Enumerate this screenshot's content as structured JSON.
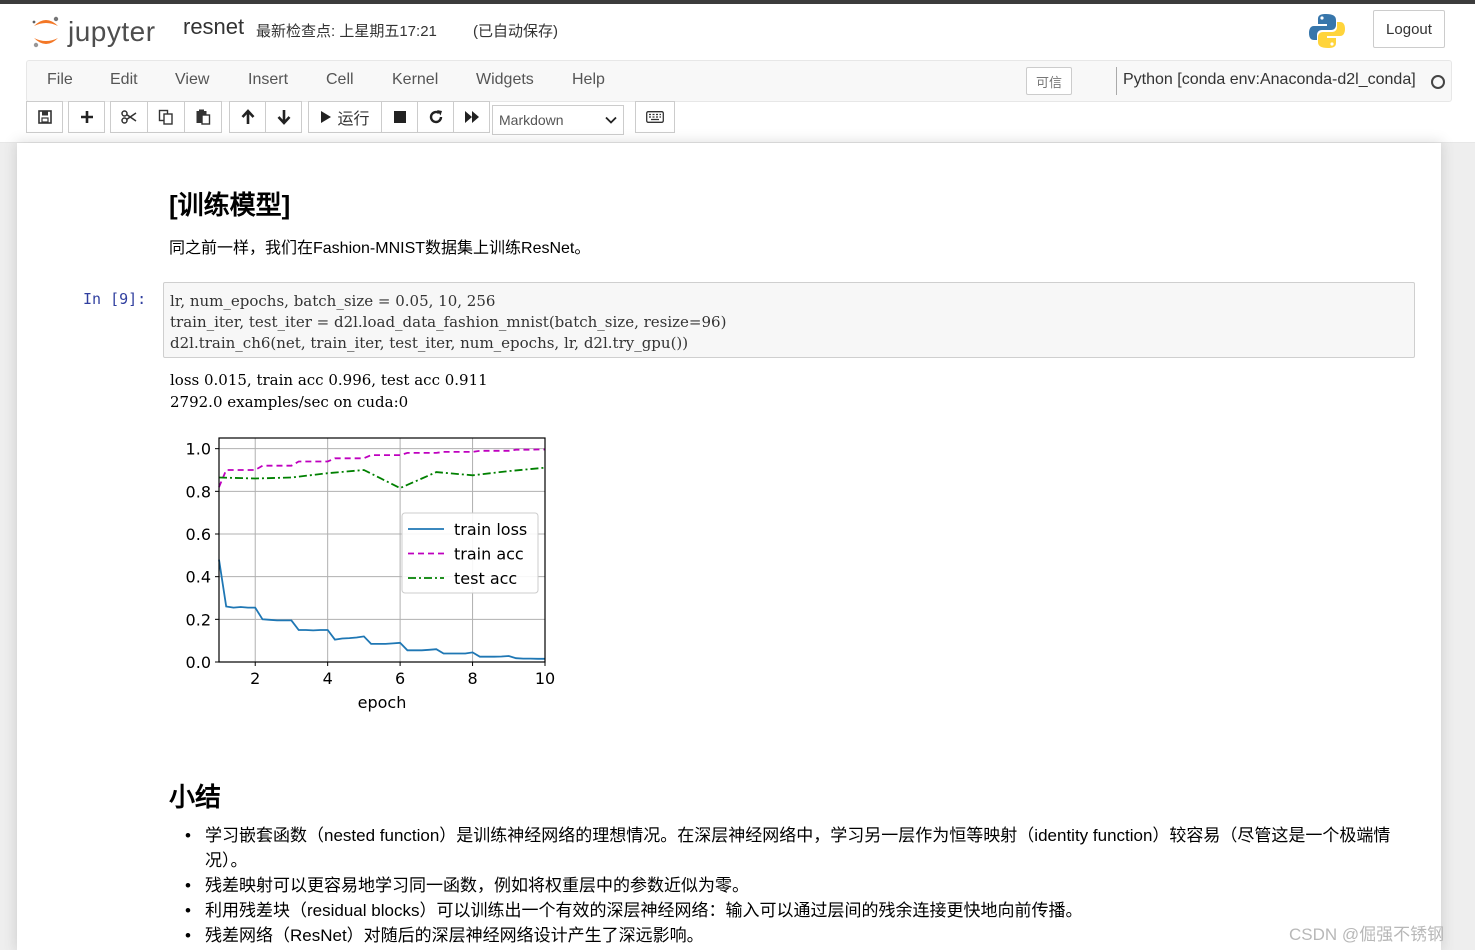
{
  "header": {
    "logo_text": "jupyter",
    "notebook_name": "resnet",
    "checkpoint": "最新检查点: 上星期五17:21",
    "autosave": "(已自动保存)",
    "logout_label": "Logout"
  },
  "menubar": {
    "items": [
      "File",
      "Edit",
      "View",
      "Insert",
      "Cell",
      "Kernel",
      "Widgets",
      "Help"
    ],
    "trusted_label": "可信",
    "kernel_name": "Python [conda env:Anaconda-d2l_conda]"
  },
  "toolbar": {
    "run_label": "运行",
    "cell_type": "Markdown"
  },
  "notebook": {
    "train_heading": "[训练模型]",
    "train_text": "同之前一样，我们在Fashion-MNIST数据集上训练ResNet。",
    "cell_prompt": "In  [9]:",
    "code": [
      "lr, num_epochs, batch_size = 0.05, 10, 256",
      "train_iter, test_iter = d2l.load_data_fashion_mnist(batch_size, resize=96)",
      "d2l.train_ch6(net, train_iter, test_iter, num_epochs, lr, d2l.try_gpu())"
    ],
    "output": [
      "loss 0.015, train acc 0.996, test acc 0.911",
      "2792.0 examples/sec on cuda:0"
    ],
    "summary_heading": "小结",
    "summary_items": [
      "学习嵌套函数（nested function）是训练神经网络的理想情况。在深层神经网络中，学习另一层作为恒等映射（identity function）较容易（尽管这是一个极端情况）。",
      "残差映射可以更容易地学习同一函数，例如将权重层中的参数近似为零。",
      "利用残差块（residual blocks）可以训练出一个有效的深层神经网络：输入可以通过层间的残余连接更快地向前传播。",
      "残差网络（ResNet）对随后的深层神经网络设计产生了深远影响。"
    ]
  },
  "watermark": "CSDN @倔强不锈钢",
  "chart_data": {
    "type": "line",
    "xlabel": "epoch",
    "ylabel": "",
    "xlim": [
      1,
      10
    ],
    "ylim": [
      0,
      1.05
    ],
    "xticks": [
      2,
      4,
      6,
      8,
      10
    ],
    "yticks": [
      "0.0",
      "0.2",
      "0.4",
      "0.6",
      "0.8",
      "1.0"
    ],
    "grid": true,
    "legend_position": "center-right",
    "series": [
      {
        "name": "train loss",
        "color": "#1f77b4",
        "style": "solid",
        "x": [
          1.0,
          1.2,
          1.4,
          1.6,
          1.8,
          2.0,
          2.2,
          2.4,
          2.6,
          2.8,
          3.0,
          3.2,
          3.4,
          3.6,
          3.8,
          4.0,
          4.2,
          4.4,
          4.6,
          4.8,
          5.0,
          5.2,
          5.4,
          5.6,
          5.8,
          6.0,
          6.2,
          6.4,
          6.6,
          6.8,
          7.0,
          7.2,
          7.4,
          7.6,
          7.8,
          8.0,
          8.2,
          8.4,
          8.6,
          8.8,
          9.0,
          9.2,
          9.4,
          9.6,
          9.8,
          10.0
        ],
        "y": [
          0.48,
          0.26,
          0.255,
          0.258,
          0.255,
          0.255,
          0.2,
          0.198,
          0.195,
          0.195,
          0.195,
          0.15,
          0.15,
          0.148,
          0.15,
          0.15,
          0.105,
          0.11,
          0.112,
          0.115,
          0.12,
          0.085,
          0.085,
          0.085,
          0.087,
          0.09,
          0.055,
          0.055,
          0.055,
          0.057,
          0.06,
          0.04,
          0.04,
          0.04,
          0.04,
          0.045,
          0.025,
          0.025,
          0.025,
          0.026,
          0.028,
          0.018,
          0.016,
          0.016,
          0.015,
          0.015
        ]
      },
      {
        "name": "train acc",
        "color": "#bf00bf",
        "style": "dashed",
        "x": [
          1.0,
          1.2,
          1.4,
          1.6,
          1.8,
          2.0,
          2.2,
          2.4,
          2.6,
          2.8,
          3.0,
          3.2,
          3.4,
          3.6,
          3.8,
          4.0,
          4.2,
          4.4,
          4.6,
          4.8,
          5.0,
          5.2,
          5.4,
          5.6,
          5.8,
          6.0,
          6.2,
          6.4,
          6.6,
          6.8,
          7.0,
          7.2,
          7.4,
          7.6,
          7.8,
          8.0,
          8.2,
          8.4,
          8.6,
          8.8,
          9.0,
          9.2,
          9.4,
          9.6,
          9.8,
          10.0
        ],
        "y": [
          0.82,
          0.9,
          0.9,
          0.9,
          0.9,
          0.9,
          0.92,
          0.92,
          0.92,
          0.92,
          0.92,
          0.94,
          0.94,
          0.94,
          0.94,
          0.94,
          0.955,
          0.955,
          0.955,
          0.955,
          0.955,
          0.97,
          0.97,
          0.97,
          0.97,
          0.97,
          0.98,
          0.98,
          0.98,
          0.98,
          0.98,
          0.985,
          0.985,
          0.985,
          0.985,
          0.985,
          0.99,
          0.99,
          0.99,
          0.99,
          0.99,
          0.995,
          0.995,
          0.995,
          0.996,
          0.996
        ]
      },
      {
        "name": "test acc",
        "color": "#008000",
        "style": "dashdot",
        "x": [
          1,
          2,
          3,
          4,
          5,
          6,
          7,
          8,
          9,
          10
        ],
        "y": [
          0.865,
          0.86,
          0.865,
          0.885,
          0.9,
          0.815,
          0.89,
          0.875,
          0.895,
          0.911
        ]
      }
    ]
  }
}
